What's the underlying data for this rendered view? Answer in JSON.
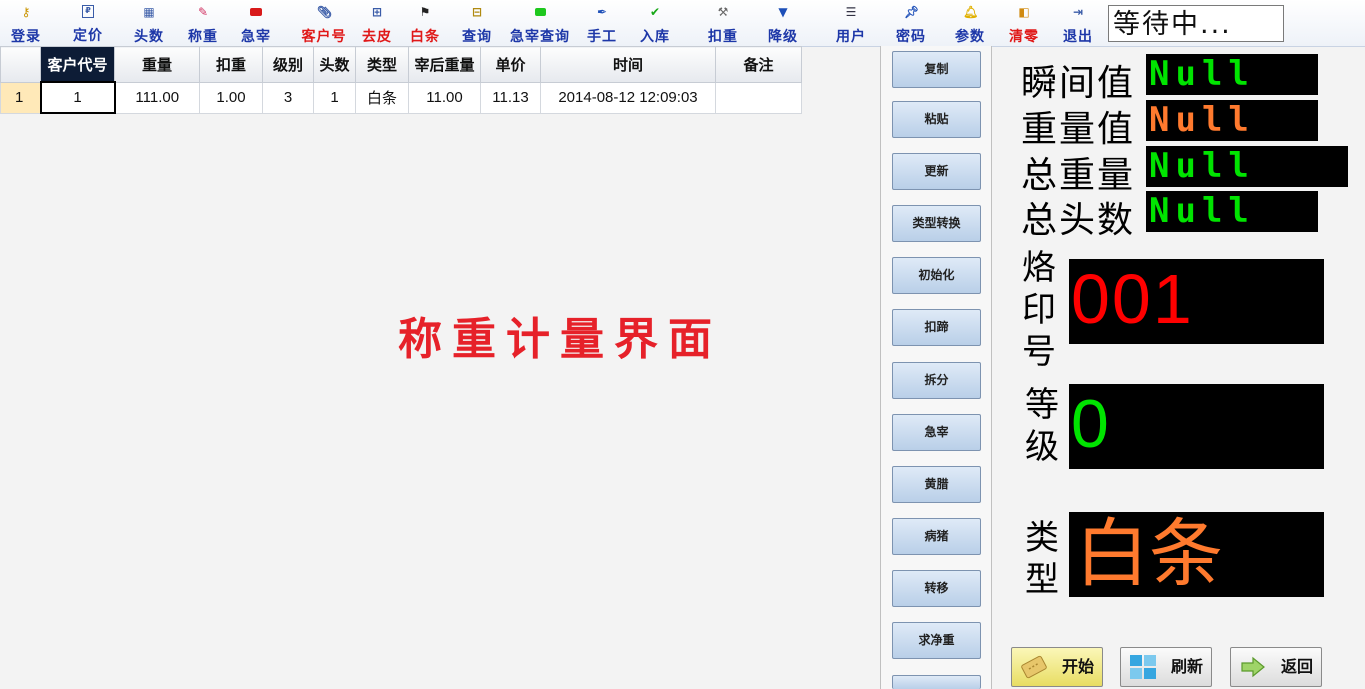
{
  "toolbar": {
    "buttons": [
      {
        "label": "登录",
        "icon": "key-icon",
        "red": false
      },
      {
        "label": "定价",
        "icon": "price-tag-icon",
        "red": false
      },
      {
        "label": "头数",
        "icon": "calendar-icon",
        "red": false
      },
      {
        "label": "称重",
        "icon": "scale-icon",
        "red": false
      },
      {
        "label": "急宰",
        "icon": "red-stop-icon",
        "red": false
      },
      {
        "label": "客户号",
        "icon": "paperclip-icon",
        "red": true
      },
      {
        "label": "去皮",
        "icon": "tree-icon",
        "red": true
      },
      {
        "label": "白条",
        "icon": "checkered-flag-icon",
        "red": true
      },
      {
        "label": "查询",
        "icon": "ruler-icon",
        "red": false
      },
      {
        "label": "急宰查询",
        "icon": "green-pill-icon",
        "red": false
      },
      {
        "label": "手工",
        "icon": "pen-icon",
        "red": false
      },
      {
        "label": "入库",
        "icon": "checkmark-icon",
        "red": false
      },
      {
        "label": "扣重",
        "icon": "hammer-icon",
        "red": false
      },
      {
        "label": "降级",
        "icon": "down-arrow-icon",
        "red": false
      },
      {
        "label": "用户",
        "icon": "list-icon",
        "red": false
      },
      {
        "label": "密码",
        "icon": "pushpin-icon",
        "red": false
      },
      {
        "label": "参数",
        "icon": "bell-icon",
        "red": false
      },
      {
        "label": "清零",
        "icon": "clear-icon",
        "red": true
      },
      {
        "label": "退出",
        "icon": "exit-door-icon",
        "red": false
      }
    ],
    "status": "等待中..."
  },
  "grid": {
    "headers": [
      "客户代号",
      "重量",
      "扣重",
      "级别",
      "头数",
      "类型",
      "宰后重量",
      "单价",
      "时间",
      "备注"
    ],
    "rows": [
      {
        "rownum": "1",
        "cells": [
          "1",
          "111.00",
          "1.00",
          "3",
          "1",
          "白条",
          "11.00",
          "11.13",
          "2014-08-12 12:09:03",
          ""
        ]
      }
    ]
  },
  "center_title": "称重计量界面",
  "side_buttons": [
    "复制",
    "粘贴",
    "更新",
    "类型转换",
    "初始化",
    "扣蹄",
    "拆分",
    "急宰",
    "黄腊",
    "病猪",
    "转移",
    "求净重"
  ],
  "readouts": [
    {
      "label": "瞬间值",
      "value": "Null",
      "color": "#00e400"
    },
    {
      "label": "重量值",
      "value": "Null",
      "color": "#ff7a2e"
    },
    {
      "label": "总重量",
      "value": "Null",
      "color": "#00e400"
    },
    {
      "label": "总头数",
      "value": "Null",
      "color": "#00e400"
    }
  ],
  "brand_no": {
    "label": "烙印号",
    "value": "001",
    "color": "#ff0000"
  },
  "grade": {
    "label": "等级",
    "value": "0",
    "color": "#00e400"
  },
  "type": {
    "label": "类型",
    "value": "白条",
    "color": "#ff7a2e"
  },
  "bottom_buttons": [
    {
      "label": "开始",
      "icon": "ticket-icon"
    },
    {
      "label": "刷新",
      "icon": "refresh-tiles-icon"
    },
    {
      "label": "返回",
      "icon": "back-arrow-icon"
    }
  ],
  "colors": {
    "accent_blue": "#1d37a8",
    "accent_red": "#e01818",
    "title_red": "#e62129"
  }
}
